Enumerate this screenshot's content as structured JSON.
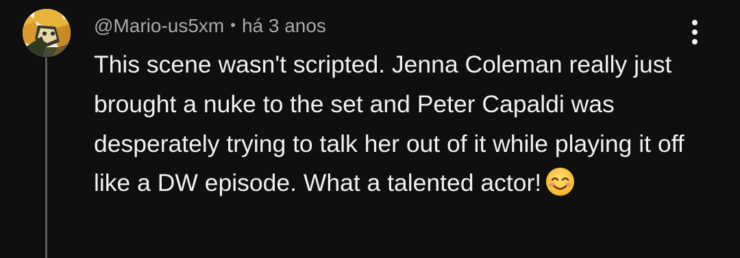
{
  "comment": {
    "author": "@Mario-us5xm",
    "separator": "•",
    "timestamp": "há 3 anos",
    "text": "This scene wasn't scripted. Jenna Coleman really just brought a nuke to the set and Peter Capaldi was desperately trying to talk her out of it while playing it off like a DW episode. What a talented actor!",
    "emoji": "smiling-face-with-smiling-eyes-icon"
  },
  "icons": {
    "avatar": "avatar-image",
    "more": "more-vert-icon"
  },
  "colors": {
    "background": "#0f0f0f",
    "text_primary": "#f1f1f1",
    "text_secondary": "#aaaaaa",
    "thread_line": "#5a5a5a"
  }
}
